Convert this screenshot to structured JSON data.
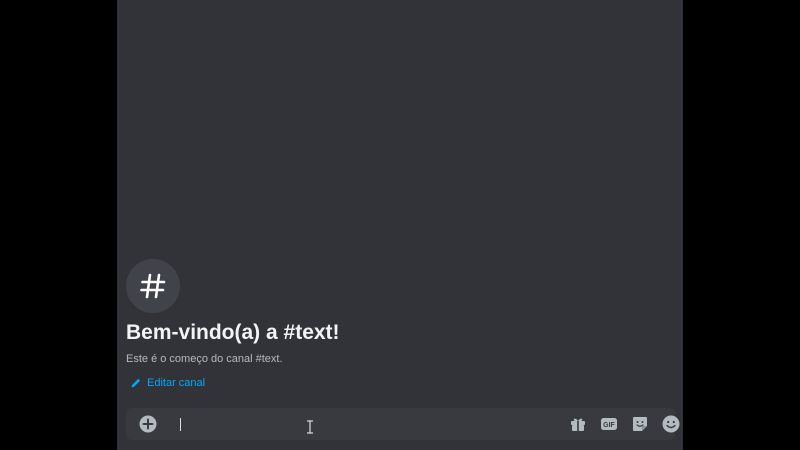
{
  "channel": {
    "avatar_glyph": "#",
    "welcome_title": "Bem-vindo(a) a #text!",
    "welcome_subtitle": "Este é o começo do canal #text.",
    "edit_label": "Editar canal"
  },
  "composer": {
    "value": "",
    "buttons": {
      "attach": "plus-circle-icon",
      "gift": "gift-icon",
      "gif": "GIF",
      "sticker": "sticker-icon",
      "emoji": "emoji-icon"
    }
  },
  "colors": {
    "background": "#313338",
    "outer": "#000000",
    "composer": "#383a40",
    "title": "#f2f3f5",
    "muted": "#b5bac1",
    "link": "#00a8fc",
    "icon": "#b5bac1"
  }
}
